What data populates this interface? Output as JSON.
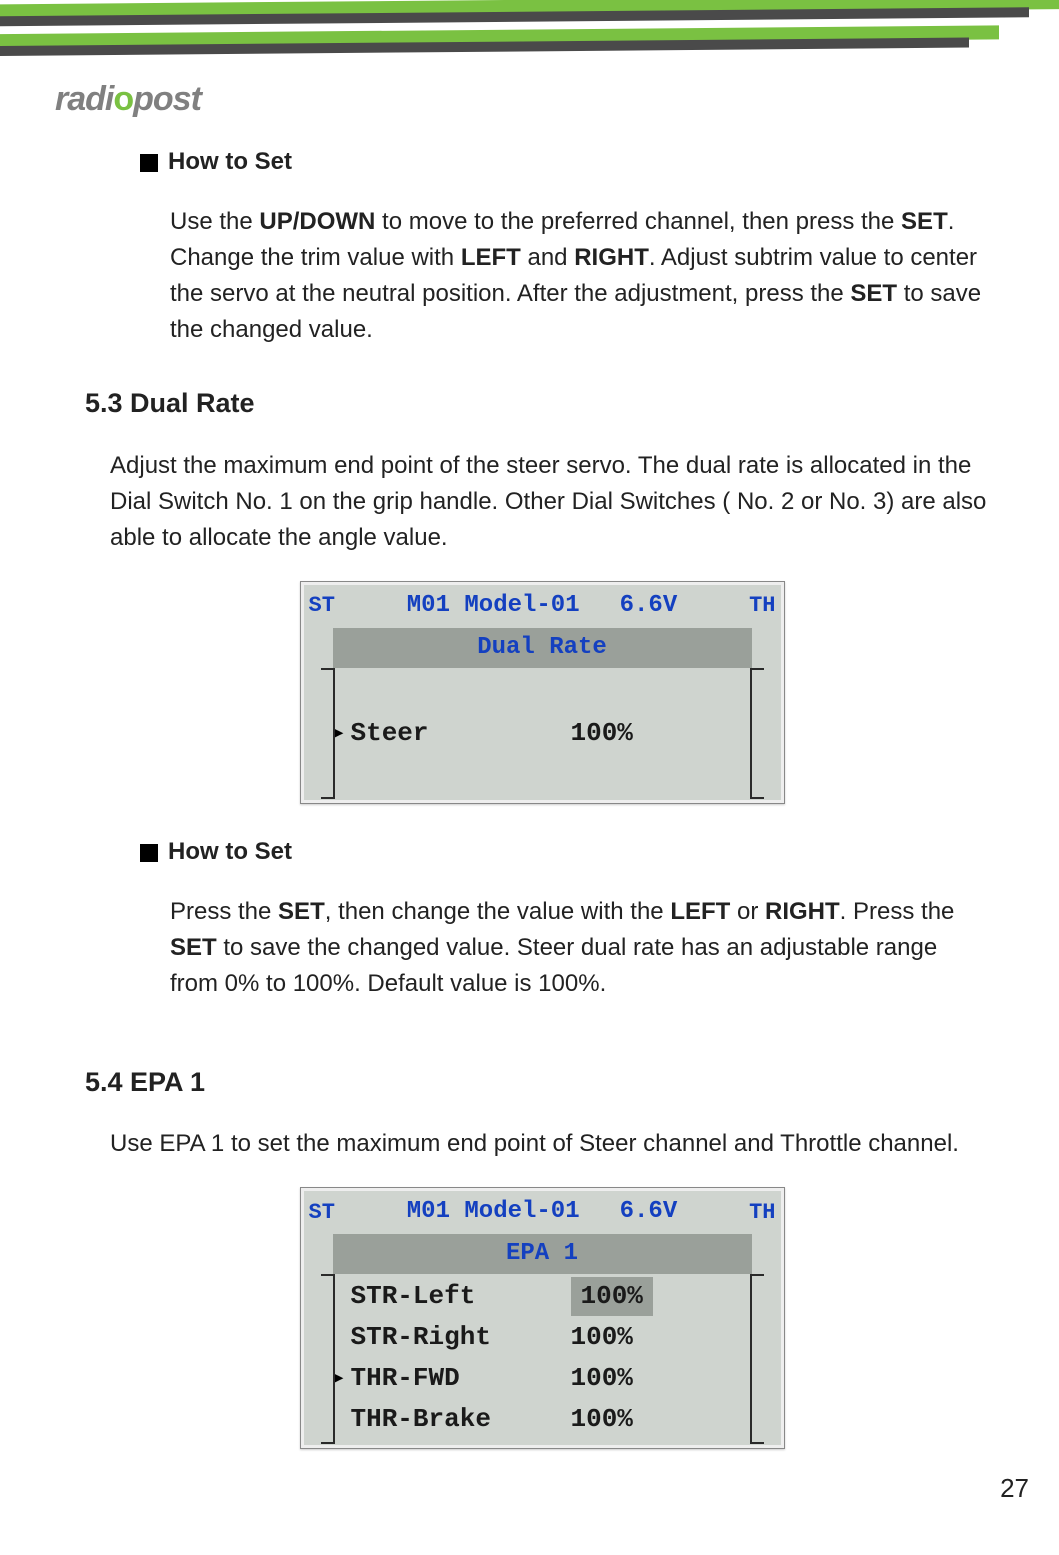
{
  "logo": {
    "text": "radiopost"
  },
  "sections": {
    "howToSet1": {
      "heading": "How to Set",
      "text_pre": "Use the ",
      "updown": "UP/DOWN",
      "text_mid1": " to move to the preferred channel, then press the ",
      "set1": "SET",
      "text_mid2": ". Change the trim value with ",
      "left": "LEFT",
      "and": " and ",
      "right": "RIGHT",
      "text_mid3": ". Adjust subtrim value to center the servo at the neutral position. After the adjustment, press the ",
      "set2": "SET",
      "text_end": " to save the changed value."
    },
    "dualRate": {
      "heading": "5.3 Dual Rate",
      "intro": "Adjust the maximum end point of the steer servo. The dual rate is allocated in the Dial Switch No. 1 on the grip handle.  Other Dial Switches ( No. 2 or No. 3) are also able to allocate the angle value."
    },
    "lcd1": {
      "st": "ST",
      "model": "M01 Model-01",
      "voltage": "6.6V",
      "th": "TH",
      "title": "Dual Rate",
      "row_label": "Steer",
      "row_value": "100%"
    },
    "howToSet2": {
      "heading": "How to Set",
      "t1": "Press the ",
      "set1": "SET",
      "t2": ", then change the value with the ",
      "left": "LEFT",
      "or": " or ",
      "right": "RIGHT",
      "t3": ". Press the ",
      "set2": "SET",
      "t4": " to save the changed value.  Steer dual rate has an adjustable range from 0% to 100%.  Default value is 100%."
    },
    "epa1": {
      "heading": "5.4  EPA 1",
      "intro": "Use EPA 1 to set the maximum end point of Steer channel and Throttle channel."
    },
    "lcd2": {
      "st": "ST",
      "model": "M01 Model-01",
      "voltage": "6.6V",
      "th": "TH",
      "title": "EPA 1",
      "rows": [
        {
          "ptr": "",
          "label": "STR-Left",
          "value": "100%",
          "highlight": true
        },
        {
          "ptr": "",
          "label": "STR-Right",
          "value": "100%",
          "highlight": false
        },
        {
          "ptr": "▸",
          "label": "THR-FWD",
          "value": "100%",
          "highlight": false
        },
        {
          "ptr": "",
          "label": "THR-Brake",
          "value": "100%",
          "highlight": false
        }
      ]
    }
  },
  "pageNumber": "27"
}
